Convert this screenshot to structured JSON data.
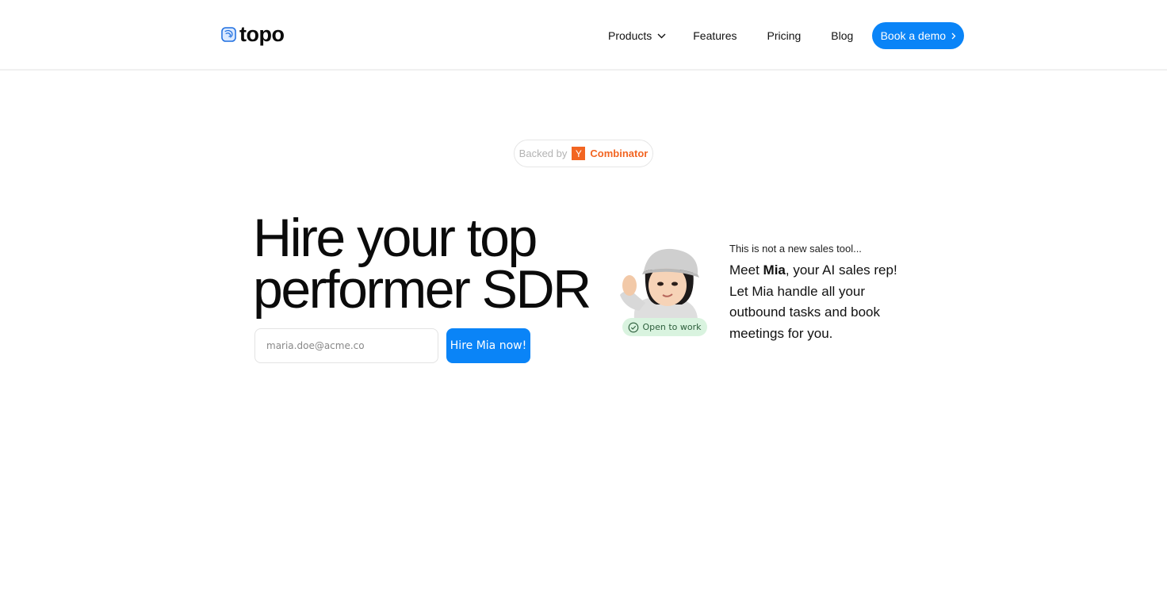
{
  "header": {
    "logo_text": "topo",
    "nav": {
      "products": "Products",
      "features": "Features",
      "pricing": "Pricing",
      "blog": "Blog"
    },
    "cta_label": "Book a demo"
  },
  "badge": {
    "prefix": "Backed by",
    "logo_letter": "Y",
    "name": "Combinator"
  },
  "hero": {
    "headline_line1": "Hire your top",
    "headline_line2": "performer SDR",
    "email_placeholder": "maria.doe@acme.co",
    "email_value": "",
    "submit_label": "Hire Mia now!"
  },
  "agent": {
    "status_label": "Open to work",
    "tagline": "This is not a new sales tool...",
    "intro_prefix": "Meet ",
    "name": "Mia",
    "intro_suffix": ", your AI sales rep!",
    "description": "Let Mia handle all your outbound tasks and book meetings for you."
  },
  "colors": {
    "accent": "#0a84f7",
    "yc_orange": "#f26522",
    "status_green_bg": "#d9f3df"
  }
}
